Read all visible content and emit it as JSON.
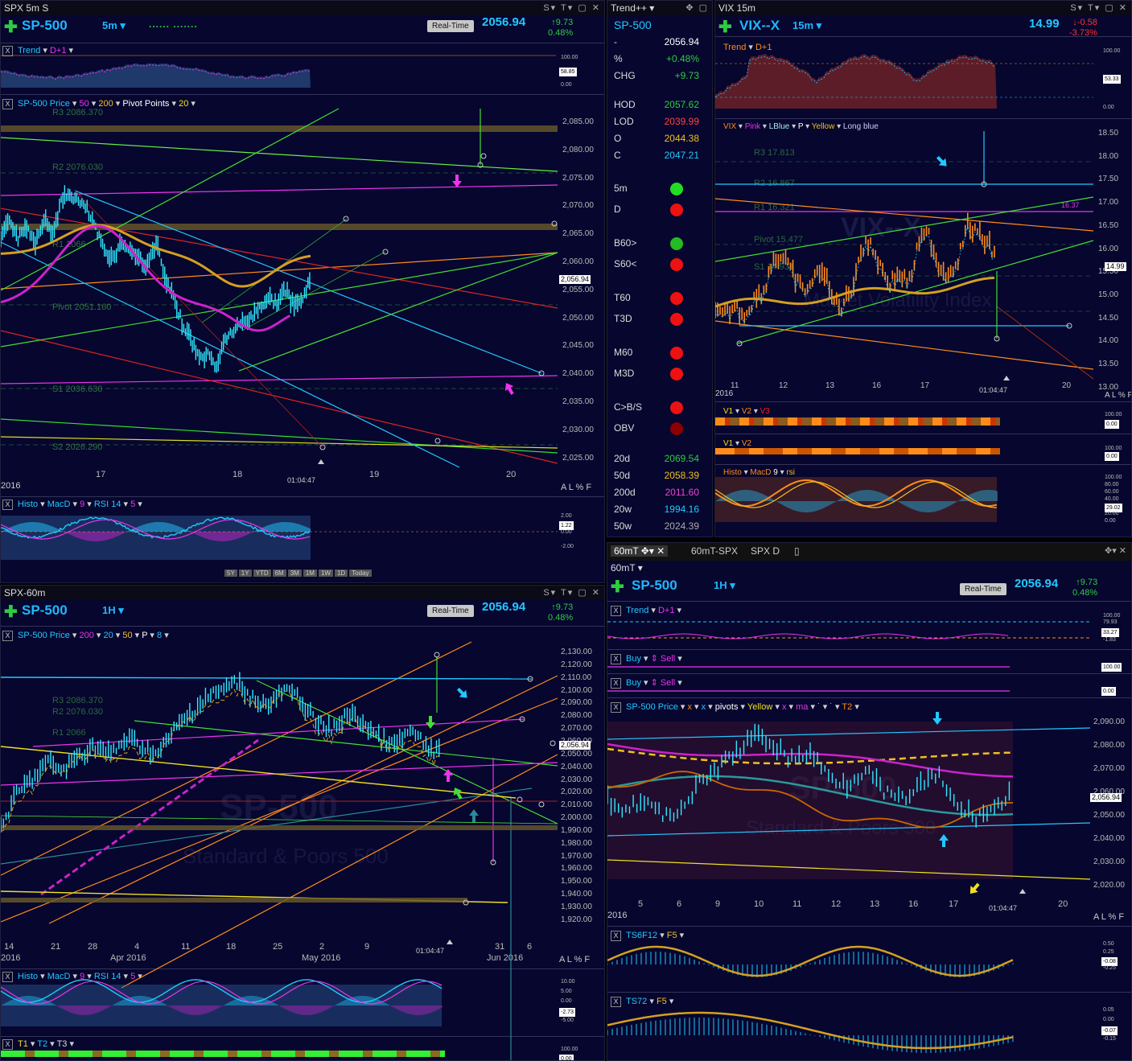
{
  "panels": {
    "tl": {
      "window_title": "SPX 5m S",
      "symbol": "SP-500",
      "interval": "5m",
      "dots": "...... .......",
      "realtime": "Real-Time",
      "last": "2056.94",
      "chg_abs": "9.73",
      "chg_pct": "0.48%",
      "trend_label": "Trend",
      "trend_d1": "D+1",
      "trend_ticks": [
        "100.00",
        "58.85",
        "0.00"
      ],
      "price_label": "SP-500 Price",
      "ma1": "50",
      "ma2": "200",
      "pivot_label": "Pivot Points",
      "pivot_n": "20",
      "y_ticks": [
        "2,085.00",
        "2,080.00",
        "2,075.00",
        "2,070.00",
        "2,065.00",
        "2,060.00",
        "2,055.00",
        "2,050.00",
        "2,045.00",
        "2,040.00",
        "2,035.00",
        "2,030.00",
        "2,025.00"
      ],
      "last_badge": "2,056.94",
      "pivot_levels": [
        "R3 2086.370",
        "R2 2076.030",
        "R1 2066",
        "Pivot 2051.160",
        "S1 2036.630",
        "S2 2026.290"
      ],
      "x_ticks": [
        "17",
        "18",
        "19",
        "20"
      ],
      "x_year": "2016",
      "time_marker": "01:04:47",
      "alp": "A L % F",
      "macd_labels": [
        "Histo",
        "MacD",
        "9",
        "RSI 14",
        "5"
      ],
      "macd_ticks": [
        "2.00",
        "1.22",
        "0.00",
        "-2.00"
      ],
      "range_buttons": [
        "5Y",
        "1Y",
        "YTD",
        "6M",
        "3M",
        "1M",
        "1W",
        "1D",
        "Today"
      ]
    },
    "tr": {
      "window_title": "VIX 15m",
      "symbol": "VIX--X",
      "interval": "15m",
      "last": "14.99",
      "chg_abs": "-0.58",
      "chg_pct": "-3.73%",
      "trend_label": "Trend",
      "trend_d1": "D+1",
      "trend_ticks": [
        "100.00",
        "53.33",
        "0.00"
      ],
      "price_labels": [
        "VIX",
        "Pink",
        "LBlue",
        "P",
        "Yellow",
        "Long blue"
      ],
      "y_ticks": [
        "18.50",
        "18.00",
        "17.50",
        "17.00",
        "16.50",
        "16.00",
        "15.50",
        "15.00",
        "14.50",
        "14.00",
        "13.50",
        "13.00"
      ],
      "last_badge": "14.99",
      "pivot_levels": [
        "R3 17.813",
        "R2 16.867",
        "R1 16.321",
        "Pivot 15.477",
        "S1 14.931"
      ],
      "r1_value": "16.37",
      "watermark": "VIX--X",
      "watermark2": "Market Volatility Index",
      "x_ticks": [
        "11",
        "12",
        "13",
        "16",
        "17",
        "20"
      ],
      "x_year": "2016",
      "time_marker": "01:04:47",
      "alp": "A L % F",
      "v_labels1": [
        "V1",
        "V2",
        "V3"
      ],
      "v_labels2": [
        "V1",
        "V2"
      ],
      "v_ticks": [
        "100.00",
        "0.00"
      ],
      "macd_labels": [
        "Histo",
        "MacD",
        "9",
        "rsi"
      ],
      "macd_ticks": [
        "100.00",
        "80.00",
        "60.00",
        "40.00",
        "29.02",
        "20.00",
        "0.00"
      ]
    },
    "side": {
      "window_title": "Trend++",
      "symbol": "SP-500",
      "rows": [
        {
          "k": "-",
          "v": "2056.94",
          "c": "#ffffff"
        },
        {
          "k": "%",
          "v": "+0.48%",
          "c": "#2ecc40"
        },
        {
          "k": "CHG",
          "v": "+9.73",
          "c": "#2ecc40"
        }
      ],
      "levels": [
        {
          "k": "HOD",
          "v": "2057.62",
          "c": "#2ecc40"
        },
        {
          "k": "LOD",
          "v": "2039.99",
          "c": "#ff4444"
        },
        {
          "k": "O",
          "v": "2044.38",
          "c": "#f0c020"
        },
        {
          "k": "C",
          "v": "2047.21",
          "c": "#22c8ff"
        }
      ],
      "signals": [
        {
          "k": "5m",
          "c": "#22dd22"
        },
        {
          "k": "D",
          "c": "#ee1111"
        },
        {
          "k": "B60>",
          "c": "#22bb22"
        },
        {
          "k": "S60<",
          "c": "#ee1111"
        },
        {
          "k": "T60",
          "c": "#ee1111"
        },
        {
          "k": "T3D",
          "c": "#ee1111"
        },
        {
          "k": "M60",
          "c": "#ee1111"
        },
        {
          "k": "M3D",
          "c": "#ee1111"
        },
        {
          "k": "C>B/S",
          "c": "#ee1111"
        },
        {
          "k": "OBV",
          "c": "#8b0000"
        }
      ],
      "mas": [
        {
          "k": "20d",
          "v": "2069.54",
          "c": "#2ecc40"
        },
        {
          "k": "50d",
          "v": "2058.39",
          "c": "#f0c020"
        },
        {
          "k": "200d",
          "v": "2011.60",
          "c": "#ee44cc"
        },
        {
          "k": "20w",
          "v": "1994.16",
          "c": "#22c8ff"
        },
        {
          "k": "50w",
          "v": "2024.39",
          "c": "#aaaaaa"
        }
      ]
    },
    "bl": {
      "window_title": "SPX-60m",
      "symbol": "SP-500",
      "interval": "1H",
      "realtime": "Real-Time",
      "last": "2056.94",
      "chg_abs": "9.73",
      "chg_pct": "0.48%",
      "price_label": "SP-500 Price",
      "ma_labels": [
        "200",
        "20",
        "50",
        "P",
        "8"
      ],
      "y_ticks": [
        "2,130.00",
        "2,120.00",
        "2,110.00",
        "2,100.00",
        "2,090.00",
        "2,080.00",
        "2,070.00",
        "2,060.00",
        "2,050.00",
        "2,040.00",
        "2,030.00",
        "2,020.00",
        "2,010.00",
        "2,000.00",
        "1,990.00",
        "1,980.00",
        "1,970.00",
        "1,960.00",
        "1,950.00",
        "1,940.00",
        "1,930.00",
        "1,920.00"
      ],
      "last_badge": "2,056.94",
      "pivot_levels": [
        "R3 2086.370",
        "R2 2076.030",
        "R1 2066"
      ],
      "watermark": "SP-500",
      "watermark2": "Standard & Poors 500",
      "x_ticks": [
        "14",
        "21",
        "28",
        "4",
        "11",
        "18",
        "25",
        "2",
        "9",
        "31",
        "6"
      ],
      "x_months": [
        "2016",
        "Apr 2016",
        "May 2016",
        "Jun 2016"
      ],
      "time_marker": "01:04:47",
      "alp": "A L % F",
      "macd_labels": [
        "Histo",
        "MacD",
        "9",
        "RSI 14",
        "5"
      ],
      "macd_ticks": [
        "10.00",
        "5.00",
        "0.00",
        "-2.73",
        "-5.00"
      ],
      "t_labels": [
        "T1",
        "T2",
        "T3"
      ],
      "t_ticks": [
        "100.00",
        "0.00"
      ]
    },
    "br": {
      "tabs": [
        "60mT",
        "60mT-SPX",
        "SPX D"
      ],
      "window_title": "60mT",
      "symbol": "SP-500",
      "interval": "1H",
      "realtime": "Real-Time",
      "last": "2056.94",
      "chg_abs": "9.73",
      "chg_pct": "0.48%",
      "trend_label": "Trend",
      "trend_d1": "D+1",
      "trend_ticks": [
        "100.00",
        "79.93",
        "33.27",
        "-1.83"
      ],
      "buy_label": "Buy",
      "sell_label": "Sell",
      "buy_ticks": [
        "100.00",
        "0.00"
      ],
      "price_labels": [
        "SP-500 Price",
        "x",
        "x",
        "pivots",
        "Yellow",
        "x",
        "ma",
        "T2"
      ],
      "y_ticks": [
        "2,090.00",
        "2,080.00",
        "2,070.00",
        "2,060.00",
        "2,050.00",
        "2,040.00",
        "2,030.00",
        "2,020.00"
      ],
      "last_badge": "2,056.94",
      "watermark": "SP-500",
      "watermark2": "Standard & Poors 500",
      "x_ticks": [
        "5",
        "6",
        "9",
        "10",
        "11",
        "12",
        "13",
        "16",
        "17",
        "20"
      ],
      "x_year": "2016",
      "time_marker": "01:04:47",
      "alp": "A L % F",
      "ts1_labels": [
        "TS6F12",
        "F5"
      ],
      "ts1_ticks": [
        "0.50",
        "0.25",
        "-0.08",
        "-0.25"
      ],
      "ts2_labels": [
        "TS72",
        "F5"
      ],
      "ts2_ticks": [
        "0.05",
        "0.00",
        "-0.07",
        "-0.15"
      ]
    }
  },
  "colors": {
    "panel_bg": "#06062e",
    "cyan": "#22c8ff",
    "green": "#2ecc40",
    "red": "#ff3333",
    "magenta": "#ee33ee",
    "orange": "#ff8c1a",
    "yellow": "#f0e020",
    "gold": "#d4a020"
  }
}
